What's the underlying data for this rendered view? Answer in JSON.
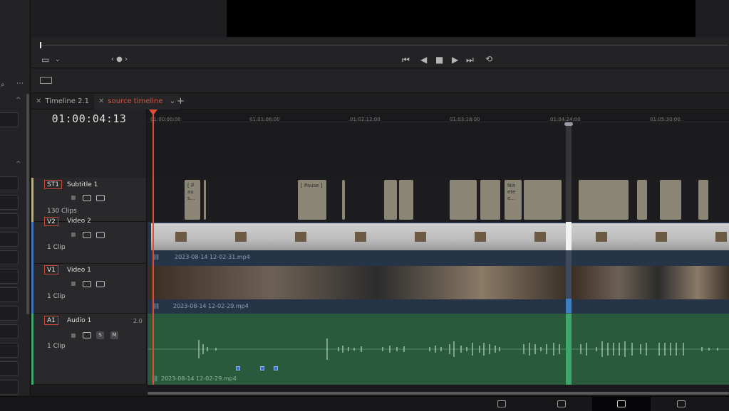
{
  "viewer": {
    "nav_dots": "‹ ● ›"
  },
  "tabs": [
    {
      "label": "Timeline 2.1",
      "active": false
    },
    {
      "label": "source timeline",
      "active": true
    }
  ],
  "timecode": "01:00:04:13",
  "ruler": {
    "labels": [
      "01:00:00:00",
      "01:01:06:00",
      "01:02:12:00",
      "01:03:18:00",
      "01:04:24:00",
      "01:05:30:00"
    ]
  },
  "tracks": {
    "subtitle": {
      "badge": "ST1",
      "name": "Subtitle 1",
      "count": "130 Clips"
    },
    "v2": {
      "badge": "V2",
      "name": "Video 2",
      "count": "1 Clip",
      "clip": "2023-08-14 12-02-31.mp4"
    },
    "v1": {
      "badge": "V1",
      "name": "Video 1",
      "count": "1 Clip",
      "clip": "2023-08-14 12-02-29.mp4"
    },
    "a1": {
      "badge": "A1",
      "name": "Audio 1",
      "channels": "2.0",
      "count": "1 Clip",
      "clip": "2023-08-14 12-02-29.mp4",
      "solo": "S",
      "mute": "M"
    }
  },
  "subtitle_clips": [
    {
      "text": "[ P au s..."
    },
    {
      "text": "[ Pause ]"
    },
    {
      "text": "Nin ete e..."
    }
  ],
  "colors": {
    "accent": "#e24a3a",
    "video_track": "#263448",
    "audio_track": "#2a5a3c",
    "subtitle_clip": "#8b8676"
  }
}
